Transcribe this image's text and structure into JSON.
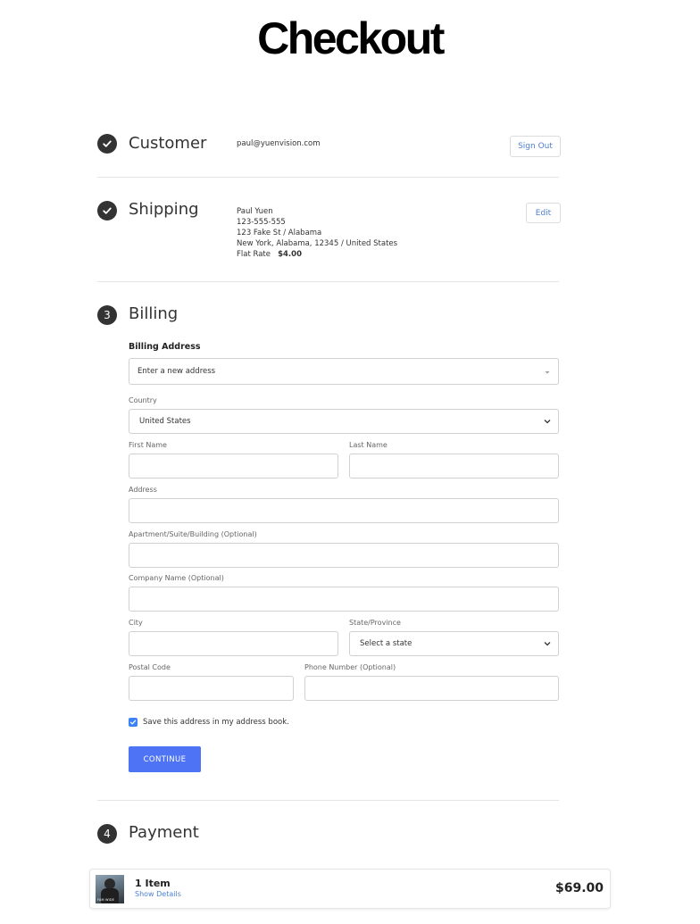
{
  "header": {
    "title": "Checkout"
  },
  "customer": {
    "step_label": "Customer",
    "email": "paul@yuenvision.com",
    "sign_out_label": "Sign Out"
  },
  "shipping": {
    "step_label": "Shipping",
    "name": "Paul Yuen",
    "phone": "123-555-555",
    "street": "123 Fake St / Alabama",
    "city_line": "New York, Alabama, 12345 / United States",
    "method_label": "Flat Rate",
    "method_price": "$4.00",
    "edit_label": "Edit"
  },
  "billing": {
    "step_number": "3",
    "step_label": "Billing",
    "section_title": "Billing Address",
    "address_select_value": "Enter a new address",
    "country_label": "Country",
    "country_value": "United States",
    "first_name_label": "First Name",
    "first_name_value": "",
    "last_name_label": "Last Name",
    "last_name_value": "",
    "address_label": "Address",
    "address_value": "",
    "apartment_label": "Apartment/Suite/Building (Optional)",
    "apartment_value": "",
    "company_label": "Company Name (Optional)",
    "company_value": "",
    "city_label": "City",
    "city_value": "",
    "state_label": "State/Province",
    "state_value": "Select a state",
    "postal_label": "Postal Code",
    "postal_value": "",
    "phone_label": "Phone Number (Optional)",
    "phone_value": "",
    "save_address_label": "Save this address in my address book.",
    "save_address_checked": true,
    "continue_label": "CONTINUE"
  },
  "payment": {
    "step_number": "4",
    "step_label": "Payment"
  },
  "cart": {
    "item_count": "1 Item",
    "details_link": "Show Details",
    "total": "$69.00",
    "thumbnail_text": "FAM WIDE"
  },
  "colors": {
    "accent": "#4e73f5",
    "link": "#4e7fd1",
    "step_icon": "#333333",
    "checkbox": "#3b82f6"
  }
}
